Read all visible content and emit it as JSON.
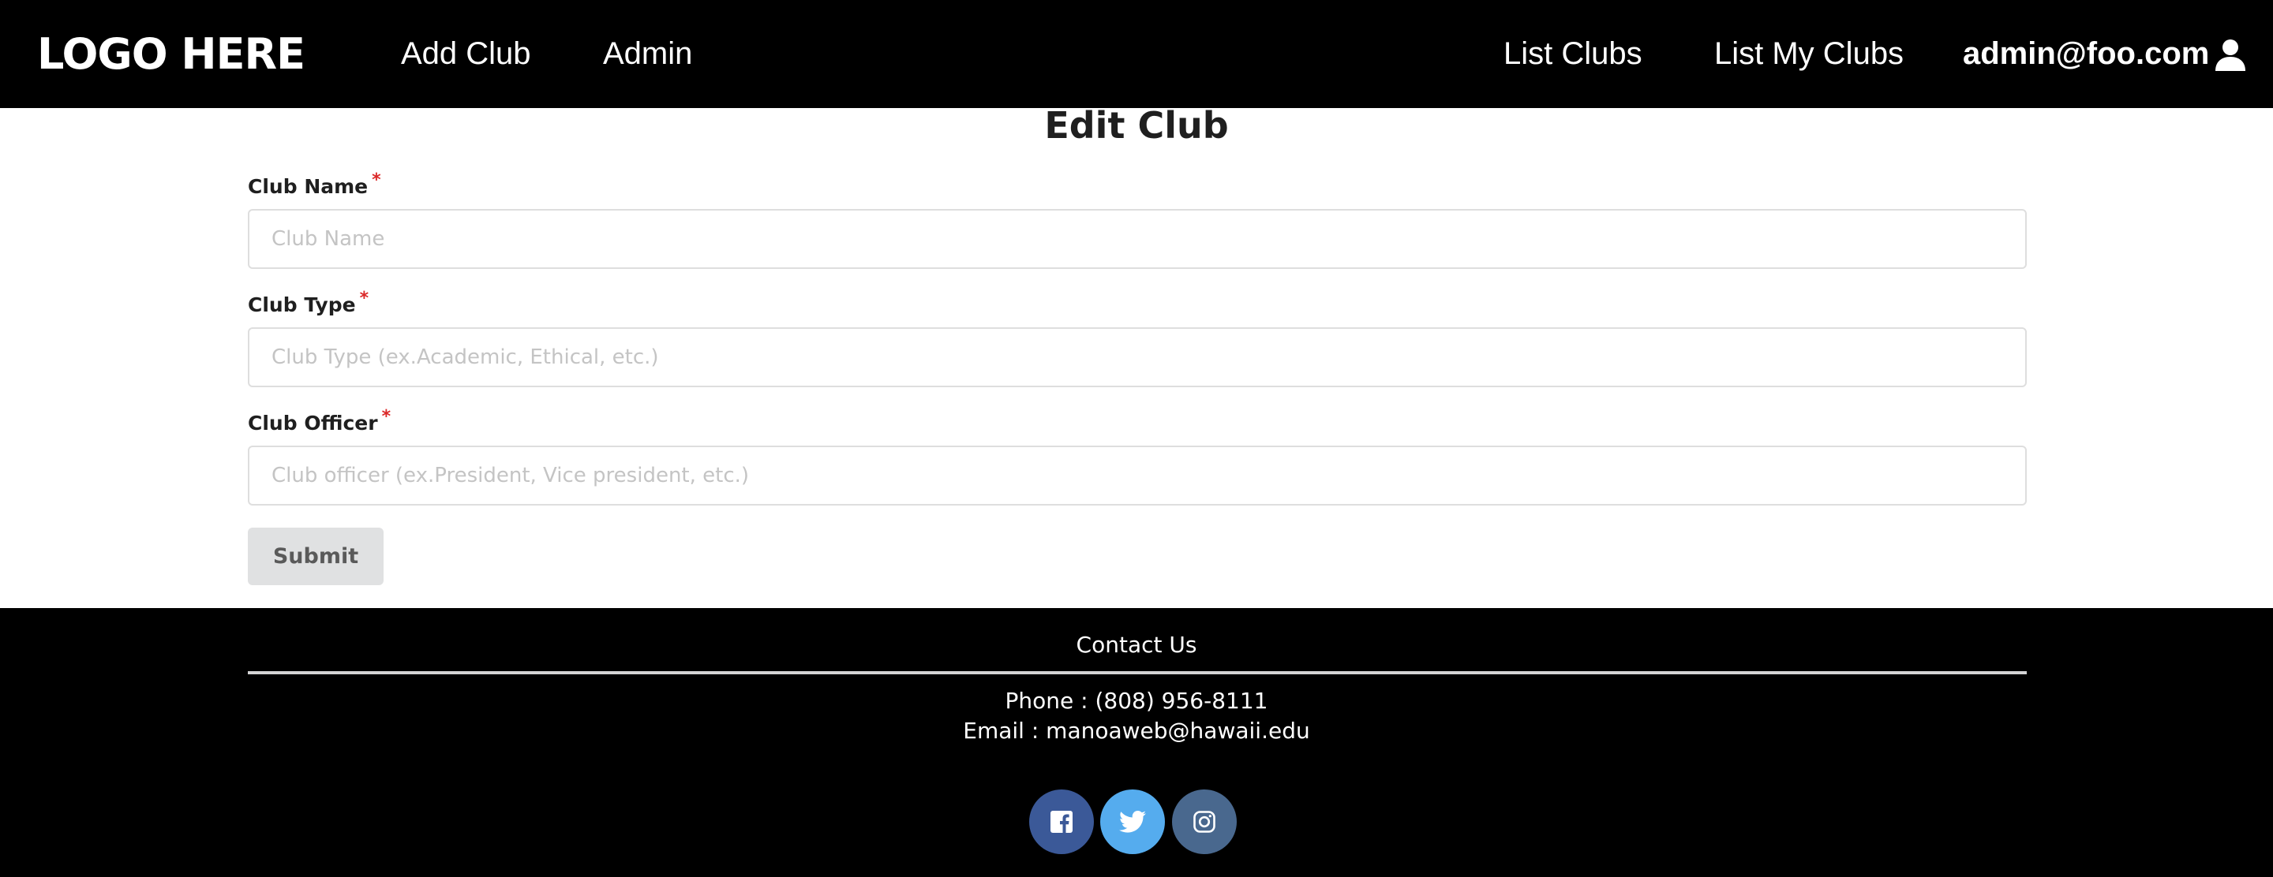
{
  "navbar": {
    "logo": "LOGO HERE",
    "links": {
      "add_club": "Add Club",
      "admin": "Admin",
      "list_clubs": "List Clubs",
      "list_my_clubs": "List My Clubs"
    },
    "user": {
      "email": "admin@foo.com",
      "icon": "user-icon"
    }
  },
  "form": {
    "title": "Edit Club",
    "required_marker": "*",
    "fields": [
      {
        "label": "Club Name",
        "placeholder": "Club Name",
        "value": ""
      },
      {
        "label": "Club Type",
        "placeholder": "Club Type (ex.Academic, Ethical, etc.)",
        "value": ""
      },
      {
        "label": "Club Officer",
        "placeholder": "Club officer (ex.President, Vice president, etc.)",
        "value": ""
      }
    ],
    "submit_label": "Submit"
  },
  "footer": {
    "heading": "Contact Us",
    "phone": "Phone : (808) 956-8111",
    "email": "Email : manoaweb@hawaii.edu",
    "social": [
      {
        "icon": "facebook-icon",
        "color": "#3b5998"
      },
      {
        "icon": "twitter-icon",
        "color": "#55acee"
      },
      {
        "icon": "instagram-icon",
        "color": "#49688e"
      }
    ]
  },
  "colors": {
    "navbar_bg": "#000000",
    "footer_bg": "#000000",
    "required": "#db2828",
    "button_bg": "#e0e1e2"
  }
}
